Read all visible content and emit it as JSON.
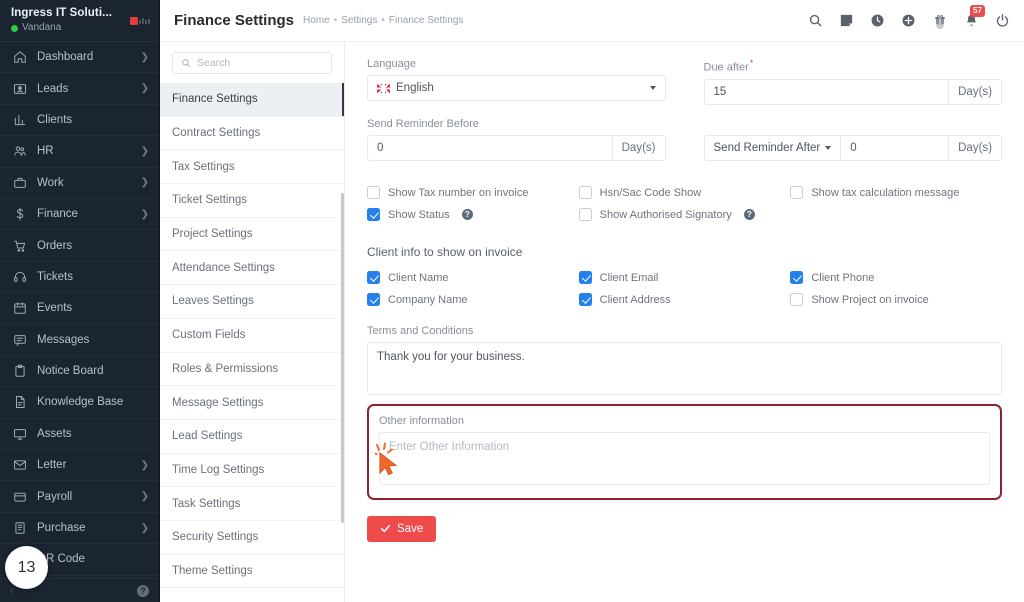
{
  "brand": {
    "company": "Ingress IT Soluti...",
    "user": "Vandana"
  },
  "sidebar": {
    "items": [
      {
        "label": "Dashboard",
        "icon": "home-icon",
        "has_chevron": true
      },
      {
        "label": "Leads",
        "icon": "id-card-icon",
        "has_chevron": true
      },
      {
        "label": "Clients",
        "icon": "chart-bar-icon",
        "has_chevron": false
      },
      {
        "label": "HR",
        "icon": "users-icon",
        "has_chevron": true
      },
      {
        "label": "Work",
        "icon": "briefcase-icon",
        "has_chevron": true
      },
      {
        "label": "Finance",
        "icon": "dollar-icon",
        "has_chevron": true
      },
      {
        "label": "Orders",
        "icon": "cart-icon",
        "has_chevron": false
      },
      {
        "label": "Tickets",
        "icon": "headset-icon",
        "has_chevron": false
      },
      {
        "label": "Events",
        "icon": "calendar-icon",
        "has_chevron": false
      },
      {
        "label": "Messages",
        "icon": "chat-icon",
        "has_chevron": false
      },
      {
        "label": "Notice Board",
        "icon": "clipboard-icon",
        "has_chevron": false
      },
      {
        "label": "Knowledge Base",
        "icon": "file-text-icon",
        "has_chevron": false
      },
      {
        "label": "Assets",
        "icon": "monitor-icon",
        "has_chevron": false
      },
      {
        "label": "Letter",
        "icon": "envelope-icon",
        "has_chevron": true
      },
      {
        "label": "Payroll",
        "icon": "wallet-icon",
        "has_chevron": true
      },
      {
        "label": "Purchase",
        "icon": "receipt-icon",
        "has_chevron": true
      },
      {
        "label": "QR Code",
        "icon": "qrcode-icon",
        "has_chevron": false
      }
    ],
    "step_badge": "13"
  },
  "header": {
    "title": "Finance Settings",
    "breadcrumb": [
      "Home",
      "Settings",
      "Finance Settings"
    ],
    "separator": "•",
    "icons": [
      "search-icon",
      "note-icon",
      "clock-icon",
      "plus-circle-icon",
      "gift-icon",
      "bell-icon",
      "power-icon"
    ],
    "notification_count": "57"
  },
  "settings_nav": {
    "search_placeholder": "Search",
    "items": [
      "Finance Settings",
      "Contract Settings",
      "Tax Settings",
      "Ticket Settings",
      "Project Settings",
      "Attendance Settings",
      "Leaves Settings",
      "Custom Fields",
      "Roles & Permissions",
      "Message Settings",
      "Lead Settings",
      "Time Log Settings",
      "Task Settings",
      "Security Settings",
      "Theme Settings"
    ],
    "active": "Finance Settings"
  },
  "form": {
    "language": {
      "label": "Language",
      "value": "English",
      "flag": "uk-flag-icon"
    },
    "due_after": {
      "label": "Due after",
      "required": true,
      "value": "15",
      "suffix": "Day(s)"
    },
    "send_reminder_before": {
      "label": "Send Reminder Before",
      "value": "0",
      "suffix": "Day(s)"
    },
    "send_reminder_after": {
      "label": "Send Reminder After",
      "value": "0",
      "suffix": "Day(s)"
    },
    "invoice_options": [
      {
        "label": "Show Tax number on invoice",
        "checked": false,
        "help": false
      },
      {
        "label": "Show Status",
        "checked": true,
        "help": true
      },
      {
        "label": "Hsn/Sac Code Show",
        "checked": false,
        "help": false
      },
      {
        "label": "Show Authorised Signatory",
        "checked": false,
        "help": true
      },
      {
        "label": "Show tax calculation message",
        "checked": false,
        "help": false
      }
    ],
    "client_info": {
      "title": "Client info to show on invoice",
      "options": [
        {
          "label": "Client Name",
          "checked": true
        },
        {
          "label": "Company Name",
          "checked": true
        },
        {
          "label": "Client Email",
          "checked": true
        },
        {
          "label": "Client Address",
          "checked": true
        },
        {
          "label": "Client Phone",
          "checked": true
        },
        {
          "label": "Show Project on invoice",
          "checked": false
        }
      ]
    },
    "terms": {
      "label": "Terms and Conditions",
      "value": "Thank you for your business.",
      "placeholder": ""
    },
    "other_information": {
      "label": "Other information",
      "value": "",
      "placeholder": "Enter Other Information"
    },
    "save_label": "Save"
  },
  "colors": {
    "accent_red": "#ef4b4b",
    "checkbox_blue": "#2680eb",
    "highlight_border": "#8e2230",
    "sidebar_bg": "#1b2431",
    "cursor_orange": "#f2672a"
  }
}
